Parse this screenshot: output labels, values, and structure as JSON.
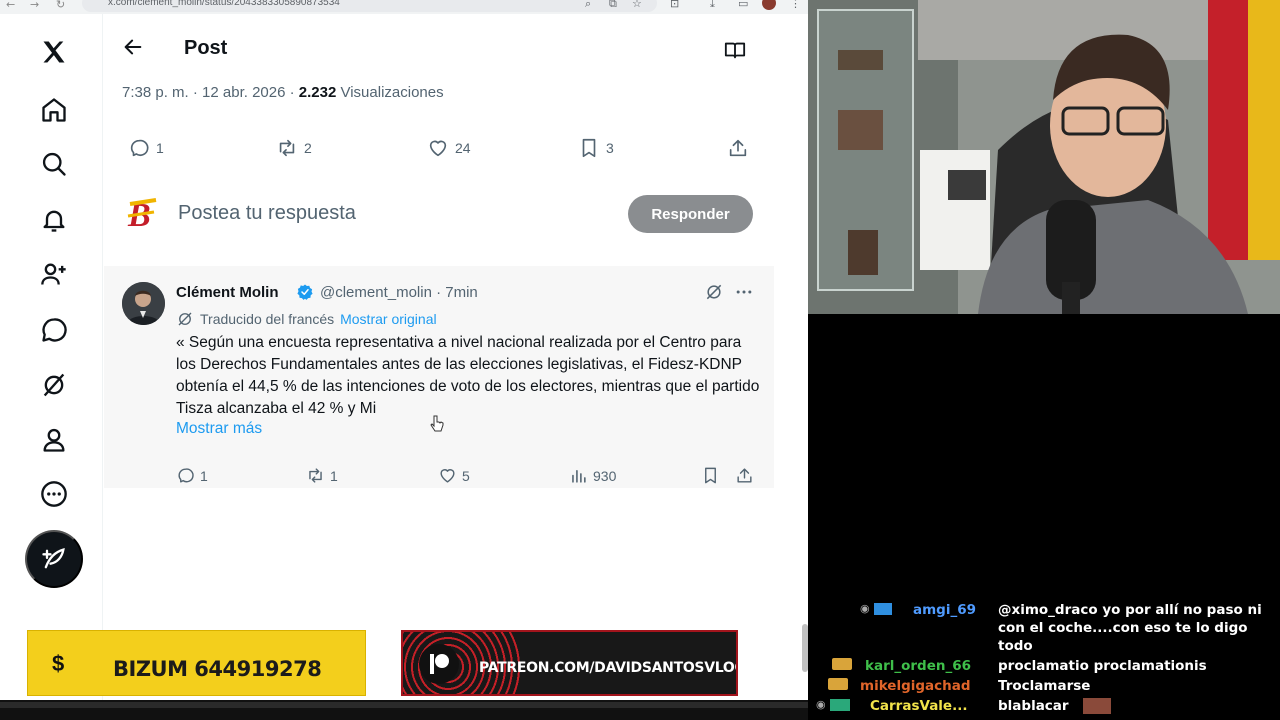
{
  "browser": {
    "url": "x.com/clement_molin/status/2043383305890873534",
    "nav_back": "←",
    "nav_forward": "→",
    "nav_reload": "↻",
    "ext_icons": [
      "zoom-icon",
      "share-icon",
      "star-icon",
      "extensions-icon",
      "download-icon",
      "profile-icon",
      "menu-icon"
    ]
  },
  "sidebar": {
    "items": [
      "x-logo-icon",
      "home-icon",
      "search-icon",
      "notifications-icon",
      "follow-icon",
      "messages-icon",
      "grok-icon",
      "profile-icon",
      "more-icon"
    ],
    "post_button_icon": "compose-icon"
  },
  "post": {
    "header_title": "Post",
    "meta_time": "7:38 p. m. · 12 abr. 2026 · ",
    "meta_views_count": "2.232",
    "meta_views_label": " Visualizaciones",
    "actions": {
      "replies": "1",
      "reposts": "2",
      "likes": "24",
      "bookmarks": "3"
    }
  },
  "reply": {
    "placeholder": "Postea tu respuesta",
    "button_label": "Responder"
  },
  "tweet": {
    "name": "Clément Molin",
    "handle": "@clement_molin · 7min",
    "translated_label": "Traducido del francés",
    "show_original": "Mostrar original",
    "text": "« Según una encuesta representativa a nivel nacional realizada por el Centro para los Derechos Fundamentales antes de las elecciones legislativas, el Fidesz-KDNP obtenía el 44,5 % de las intenciones de voto de los electores, mientras que el partido Tisza alcanzaba el 42 % y Mi",
    "show_more": "Mostrar más",
    "actions": {
      "replies": "1",
      "reposts": "1",
      "likes": "5",
      "views": "930"
    }
  },
  "banners": {
    "bizum_sign": "$",
    "bizum": "BIZUM 644919278",
    "patreon": "PATREON.COM/DAVIDSANTOSVLOG"
  },
  "chat": [
    {
      "user": "amgi_69",
      "color": "#4f9bff",
      "text": "@ximo_draco yo por allí no paso ni con el coche....con eso te lo digo todo"
    },
    {
      "user": "karl_orden_66",
      "color": "#3fbf4a",
      "text": "proclamatio proclamationis"
    },
    {
      "user": "mikelgigachad",
      "color": "#e0652a",
      "text": "Troclamarse"
    },
    {
      "user": "CarrasVale...",
      "color": "#f2e34a",
      "text": "blablacar"
    }
  ]
}
